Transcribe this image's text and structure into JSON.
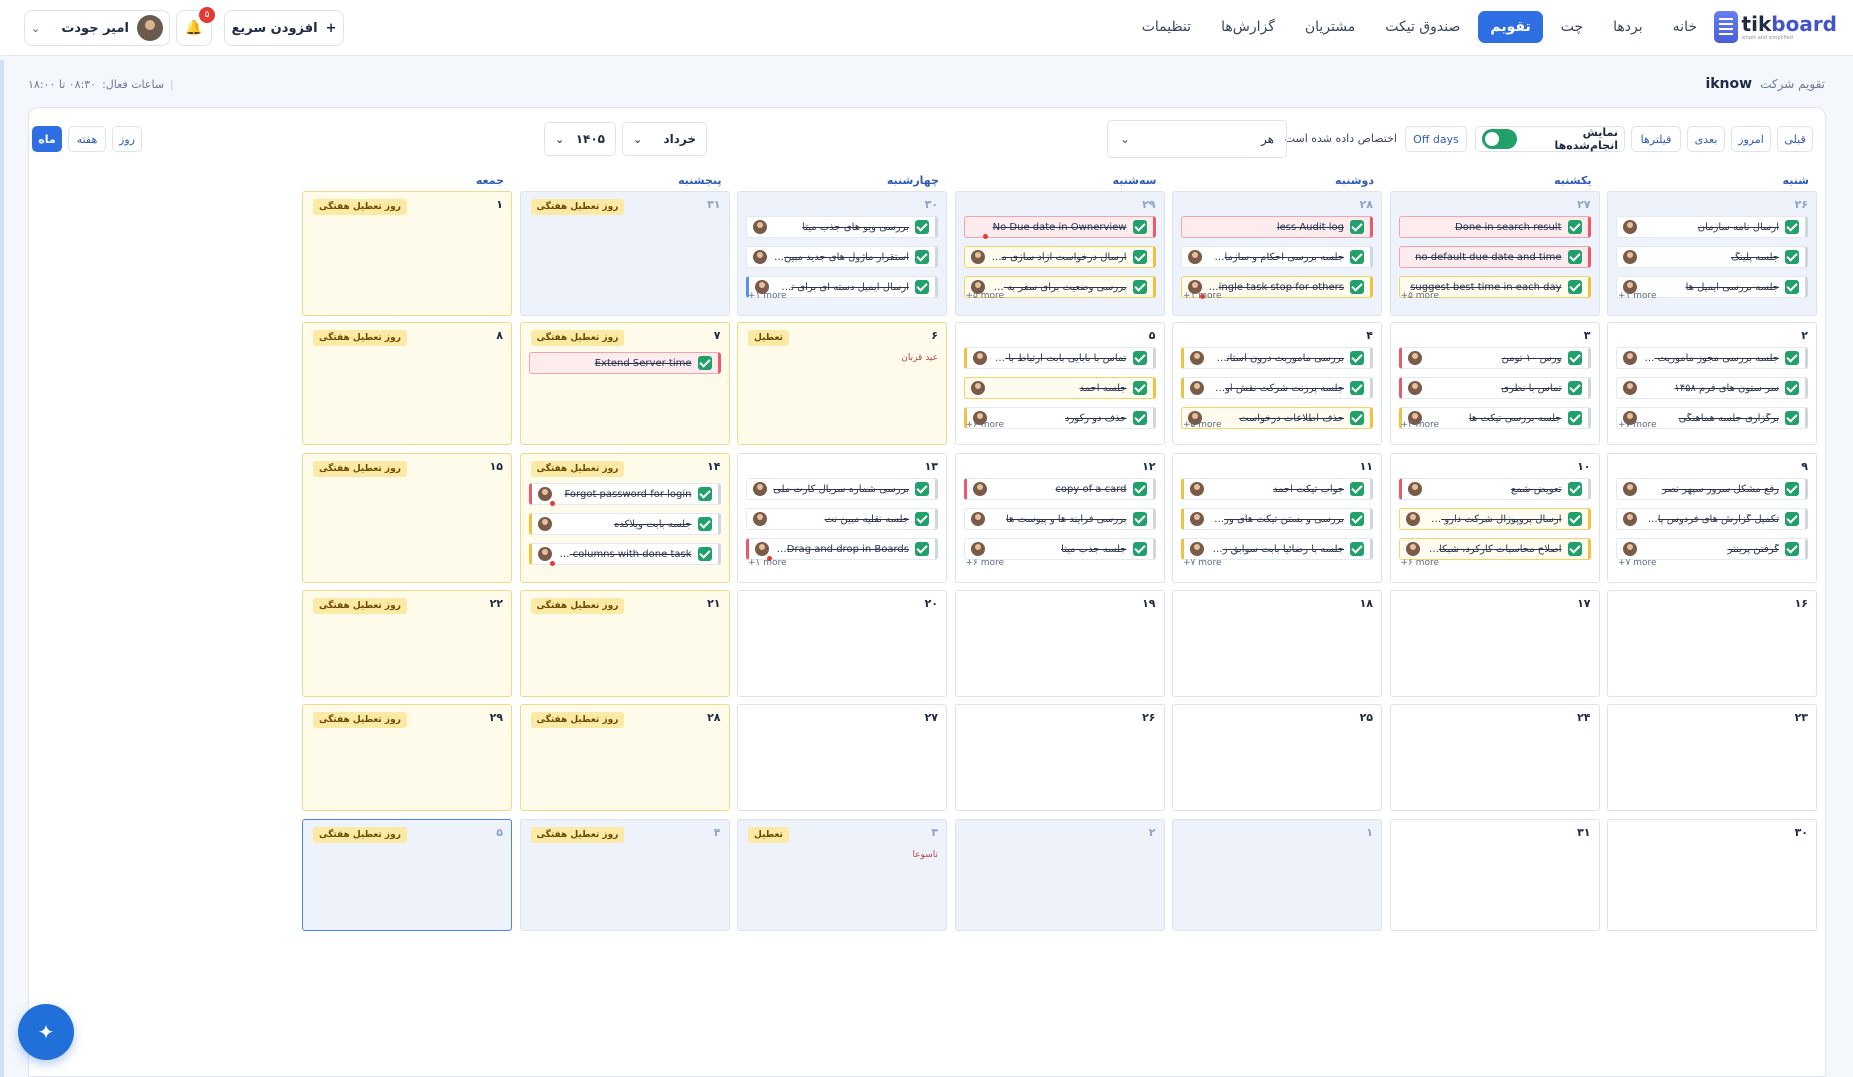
{
  "app": {
    "logo_tik": "tik",
    "logo_board": "board",
    "logo_tagline": "smart and simplified"
  },
  "nav": [
    {
      "label": "خانه",
      "active": false
    },
    {
      "label": "بردها",
      "active": false
    },
    {
      "label": "چت",
      "active": false
    },
    {
      "label": "تقویم",
      "active": true
    },
    {
      "label": "صندوق تیکت",
      "active": false
    },
    {
      "label": "مشتریان",
      "active": false
    },
    {
      "label": "گزارش‌ها",
      "active": false
    },
    {
      "label": "تنظیمات",
      "active": false
    }
  ],
  "header": {
    "user_name": "امیر جودت",
    "notification_count": "۵",
    "quick_add_label": "افزودن سریع",
    "quick_add_icon": "+"
  },
  "subheader": {
    "breadcrumb": "تقویم شرکت",
    "company": "iknow",
    "hours_label": "ساعات فعال:",
    "hours_value": "۰۸:۳۰ تا ۱۸:۰۰"
  },
  "toolbar": {
    "prev": "قبلی",
    "today": "امروز",
    "next": "بعدی",
    "filters": "فیلترها",
    "show_done": "نمایش انجام‌شده‌ها",
    "show_done_on": true,
    "off_days": "Off days",
    "assigned_label": "اختصاص داده شده است",
    "assigned_value": "هر",
    "month_select": "خرداد",
    "year_select": "۱۴۰۵",
    "view_day": "روز",
    "view_week": "هفته",
    "view_month": "ماه",
    "active_view": "month"
  },
  "weekdays": [
    "شنبه",
    "یکشنبه",
    "دوشنبه",
    "سه‌شنبه",
    "چهارشنبه",
    "پنجشنبه",
    "جمعه"
  ],
  "weeks": [
    [
      {
        "num": "۲۶",
        "out": true,
        "more": "+۱ more",
        "tasks": [
          {
            "t": "ارسال نامه سازمان",
            "c": "grey"
          },
          {
            "t": "جلسه پلینگ",
            "c": "grey"
          },
          {
            "t": "جلسه بررسی ایمیل ها",
            "c": "grey"
          }
        ]
      },
      {
        "num": "۲۷",
        "out": true,
        "more": "+۵ more",
        "tasks": [
          {
            "t": "Done in search result",
            "c": "red",
            "noav": true
          },
          {
            "t": "no default due date and time",
            "c": "red",
            "noav": true
          },
          {
            "t": "suggest best time in each day",
            "c": "yellow",
            "noav": true
          }
        ]
      },
      {
        "num": "۲۸",
        "out": true,
        "more": "+۱ more",
        "tasks": [
          {
            "t": "less Audit log",
            "c": "red",
            "noav": true
          },
          {
            "t": "جلسه بررسی احکام و سازمان eoi",
            "c": "grey"
          },
          {
            "t": "Others Single task stop for others",
            "c": "yellow",
            "dot": true
          }
        ]
      },
      {
        "num": "۲۹",
        "out": true,
        "more": "+۵ more",
        "tasks": [
          {
            "t": "No Due date in Ownerview",
            "c": "red",
            "noav": true,
            "dot": true
          },
          {
            "t": "ارسال درخواست آزاد سازی مبلغ بیمه",
            "c": "yellow"
          },
          {
            "t": "بررسی وضعیت برای سفر به ساری ...",
            "c": "yellow"
          }
        ]
      },
      {
        "num": "۳۰",
        "out": true,
        "more": "+۱ more",
        "tasks": [
          {
            "t": "بررسی ویو های جذب میتا",
            "c": "grey"
          },
          {
            "t": "استقرار ماژول های جدید مبین نت",
            "c": "grey"
          },
          {
            "t": "ارسال ایمیل دسته ای برای تست",
            "c": "grey",
            "edge": "blue"
          }
        ]
      },
      {
        "num": "۳۱",
        "out": true,
        "tag": "روز تعطیل هفتگی"
      },
      {
        "num": "۱",
        "off": true,
        "tag": "روز تعطیل هفتگی"
      }
    ],
    [
      {
        "num": "۲",
        "more": "+۷ more",
        "tasks": [
          {
            "t": "جلسه بررسی مجوز ماموریت - توسعه...",
            "c": "grey"
          },
          {
            "t": "سر ستون های فرم ۱۴۵۸",
            "c": "grey"
          },
          {
            "t": "برگزاری جلسه هماهنگی",
            "c": "grey"
          }
        ]
      },
      {
        "num": "۳",
        "more": "+۲ more",
        "tasks": [
          {
            "t": "ورس ۱۰ تومن",
            "c": "grey",
            "edge": "red"
          },
          {
            "t": "تماس با نظری",
            "c": "grey",
            "edge": "red"
          },
          {
            "t": "جلسه بررسی تیکت ها",
            "c": "grey",
            "edge": "yellow"
          }
        ]
      },
      {
        "num": "۴",
        "more": "+۵ more",
        "tasks": [
          {
            "t": "بررسی ماموریت درون استانی در توس...",
            "c": "grey",
            "edge": "yellow"
          },
          {
            "t": "جلسه پررنت شرکت نقش اول برتر پایا",
            "c": "grey",
            "edge": "yellow"
          },
          {
            "t": "حذف اطلاعات درخواست",
            "c": "yellow"
          }
        ]
      },
      {
        "num": "۵",
        "more": "+۶ more",
        "tasks": [
          {
            "t": "تماس با بابایی بابت ارتباط با سرور",
            "c": "grey",
            "edge": "yellow"
          },
          {
            "t": "جلسه احمد",
            "c": "yellow"
          },
          {
            "t": "حذف دو رکورد",
            "c": "grey",
            "edge": "yellow"
          }
        ]
      },
      {
        "num": "۶",
        "off": true,
        "tag": "تعطیل",
        "holiday": "عید قربان"
      },
      {
        "num": "۷",
        "off": true,
        "tag": "روز تعطیل هفتگی",
        "tasks": [
          {
            "t": "Extend Server time",
            "c": "red",
            "noav": true
          }
        ]
      },
      {
        "num": "۸",
        "off": true,
        "tag": "روز تعطیل هفتگی"
      }
    ],
    [
      {
        "num": "۹",
        "more": "+۷ more",
        "tasks": [
          {
            "t": "رفع مشکل سرور سپهر نصر",
            "c": "grey"
          },
          {
            "t": "تکمیل گزارش های فردوس پارس",
            "c": "grey"
          },
          {
            "t": "گرفتن پرینتر",
            "c": "grey"
          }
        ]
      },
      {
        "num": "۱۰",
        "more": "+۶ more",
        "tasks": [
          {
            "t": "تعویض شمع",
            "c": "grey",
            "edge": "red"
          },
          {
            "t": "ارسال پروپوزال شرکت دارو سازی اسوه",
            "c": "yellow"
          },
          {
            "t": "اصلاح محاسبات کارکرد، شبکاری و ...",
            "c": "yellow"
          }
        ]
      },
      {
        "num": "۱۱",
        "more": "+۷ more",
        "tasks": [
          {
            "t": "جواب تیکت احمد",
            "c": "grey",
            "edge": "yellow"
          },
          {
            "t": "بررسی و بستن تیکت های ورژن ۱۱۰...",
            "c": "grey",
            "edge": "yellow"
          },
          {
            "t": "جلسه با رضائیا بابت سوابق زبان خار...",
            "c": "grey",
            "edge": "yellow"
          }
        ]
      },
      {
        "num": "۱۲",
        "more": "+۶ more",
        "tasks": [
          {
            "t": "copy of a card",
            "c": "grey",
            "edge": "red"
          },
          {
            "t": "بررسی فرآیند ها و پیوست ها",
            "c": "grey"
          },
          {
            "t": "جلسه جذب میتا",
            "c": "grey"
          }
        ]
      },
      {
        "num": "۱۳",
        "more": "+۱ more",
        "tasks": [
          {
            "t": "بررسی شماره سریال کارت ملی",
            "c": "grey"
          },
          {
            "t": "جلسه نقلیه مبین نت",
            "c": "grey"
          },
          {
            "t": "List Drag and drop in Boards",
            "c": "grey",
            "edge": "red",
            "dot": true
          }
        ]
      },
      {
        "num": "۱۴",
        "off": true,
        "tag": "روز تعطیل هفتگی",
        "tasks": [
          {
            "t": "Forgot password for login",
            "c": "grey",
            "edge": "red",
            "dot": true
          },
          {
            "t": "جلسه بابت ویلاکده",
            "c": "grey",
            "edge": "yellow"
          },
          {
            "t": "tasks in columns with done task...",
            "c": "grey",
            "edge": "yellow",
            "dot": true
          }
        ]
      },
      {
        "num": "۱۵",
        "off": true,
        "tag": "روز تعطیل هفتگی"
      }
    ],
    [
      {
        "num": "۱۶"
      },
      {
        "num": "۱۷"
      },
      {
        "num": "۱۸"
      },
      {
        "num": "۱۹"
      },
      {
        "num": "۲۰"
      },
      {
        "num": "۲۱",
        "off": true,
        "tag": "روز تعطیل هفتگی"
      },
      {
        "num": "۲۲",
        "off": true,
        "tag": "روز تعطیل هفتگی"
      }
    ],
    [
      {
        "num": "۲۳"
      },
      {
        "num": "۲۴"
      },
      {
        "num": "۲۵"
      },
      {
        "num": "۲۶"
      },
      {
        "num": "۲۷"
      },
      {
        "num": "۲۸",
        "off": true,
        "tag": "روز تعطیل هفتگی"
      },
      {
        "num": "۲۹",
        "off": true,
        "tag": "روز تعطیل هفتگی"
      }
    ],
    [
      {
        "num": "۳۰"
      },
      {
        "num": "۳۱"
      },
      {
        "num": "۱",
        "out": true
      },
      {
        "num": "۲",
        "out": true
      },
      {
        "num": "۳",
        "out": true,
        "tag": "تعطیل",
        "holiday": "تاسوعا"
      },
      {
        "num": "۴",
        "out": true,
        "tag": "روز تعطیل هفتگی"
      },
      {
        "num": "۵",
        "out": true,
        "today": true,
        "tag": "روز تعطیل هفتگی"
      }
    ]
  ]
}
